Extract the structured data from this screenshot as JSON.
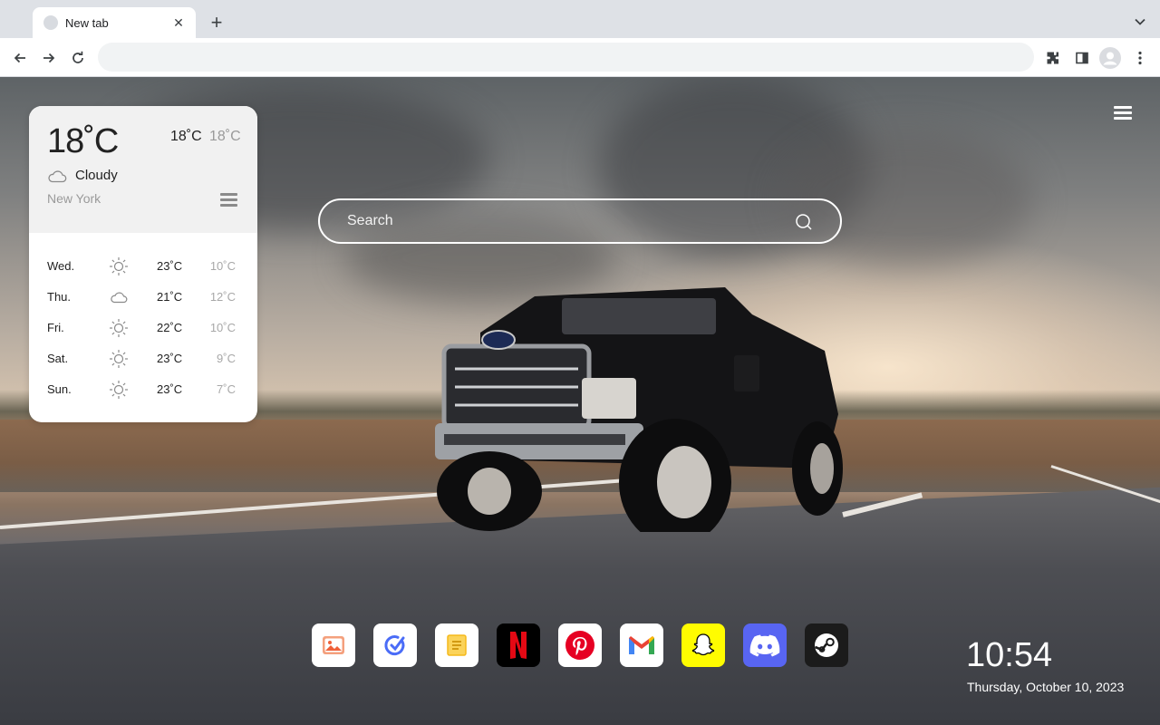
{
  "browser": {
    "tab_title": "New tab",
    "tab_close_symbol": "✕",
    "new_tab_symbol": "+",
    "omnibox_value": ""
  },
  "search": {
    "placeholder": "Search"
  },
  "weather": {
    "current_temp": "18˚C",
    "high": "18˚C",
    "low": "18˚C",
    "condition": "Cloudy",
    "condition_icon": "cloud-icon",
    "city": "New York",
    "forecast": [
      {
        "day": "Wed.",
        "icon": "sun-icon",
        "high": "23˚C",
        "low": "10˚C"
      },
      {
        "day": "Thu.",
        "icon": "cloud-icon",
        "high": "21˚C",
        "low": "12˚C"
      },
      {
        "day": "Fri.",
        "icon": "sun-icon",
        "high": "22˚C",
        "low": "10˚C"
      },
      {
        "day": "Sat.",
        "icon": "sun-icon",
        "high": "23˚C",
        "low": "9˚C"
      },
      {
        "day": "Sun.",
        "icon": "sun-icon",
        "high": "23˚C",
        "low": "7˚C"
      }
    ]
  },
  "shortcuts": [
    {
      "name": "photos",
      "icon": "image-icon",
      "bg": "#ffffff",
      "fg": "#f0613a"
    },
    {
      "name": "todo",
      "icon": "check-circle-icon",
      "bg": "#ffffff",
      "fg": "#4a6cf7"
    },
    {
      "name": "notes",
      "icon": "note-icon",
      "bg": "#ffffff",
      "fg": "#f5b91b"
    },
    {
      "name": "netflix",
      "icon": "netflix-icon",
      "bg": "#000000",
      "fg": "#e50914"
    },
    {
      "name": "pinterest",
      "icon": "pinterest-icon",
      "bg": "#ffffff",
      "fg": "#e60023"
    },
    {
      "name": "gmail",
      "icon": "gmail-icon",
      "bg": "#ffffff",
      "fg": "#ea4335"
    },
    {
      "name": "snapchat",
      "icon": "snapchat-icon",
      "bg": "#fffc00",
      "fg": "#ffffff"
    },
    {
      "name": "discord",
      "icon": "discord-icon",
      "bg": "#5865f2",
      "fg": "#ffffff"
    },
    {
      "name": "steam",
      "icon": "steam-icon",
      "bg": "#1b1b1b",
      "fg": "#ffffff"
    }
  ],
  "clock": {
    "time": "10:54",
    "date": "Thursday, October 10, 2023"
  },
  "colors": {
    "chrome_bg": "#dee1e6",
    "omnibox_bg": "#f1f3f4",
    "card_top_bg": "#f1f1f1"
  }
}
